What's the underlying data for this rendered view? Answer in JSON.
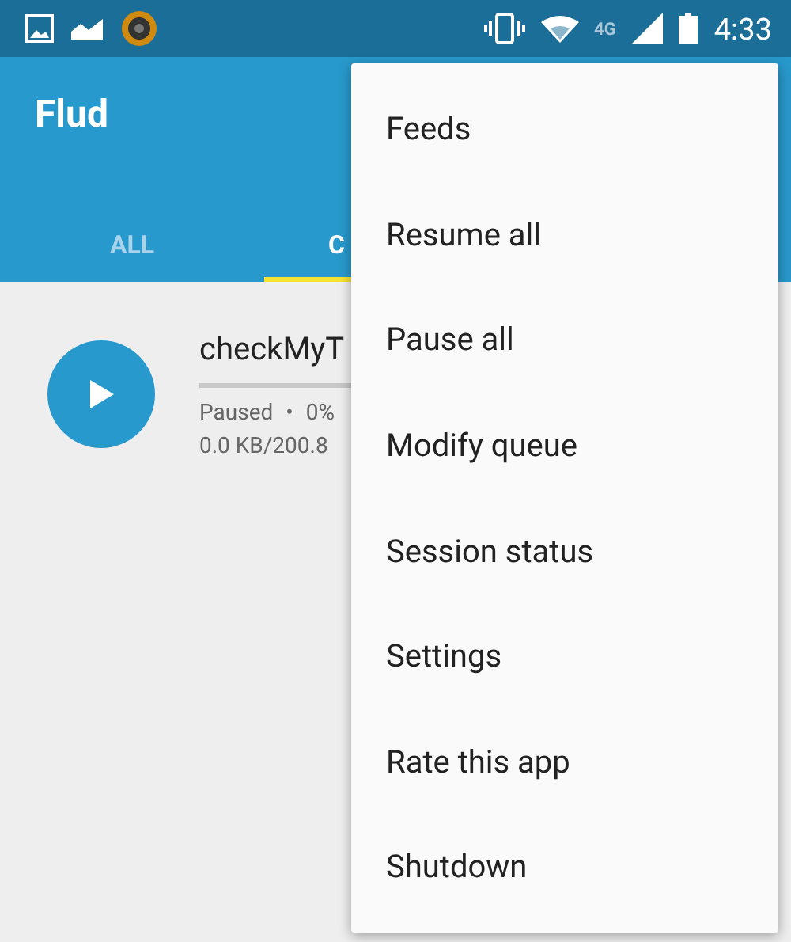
{
  "status_bar": {
    "network": "4G",
    "time": "4:33"
  },
  "app_bar": {
    "title": "Flud"
  },
  "tabs": [
    {
      "label": "ALL",
      "selected": false
    },
    {
      "label": "C",
      "selected": true
    }
  ],
  "torrents": [
    {
      "name": "checkMyT",
      "level": 0,
      "status": "Paused",
      "separator": "•",
      "percent": "0%",
      "size": "0.0 KB/200.8"
    }
  ],
  "menu": {
    "items": [
      "Feeds",
      "Resume all",
      "Pause all",
      "Modify queue",
      "Session status",
      "Settings",
      "Rate this app",
      "Shutdown"
    ]
  }
}
